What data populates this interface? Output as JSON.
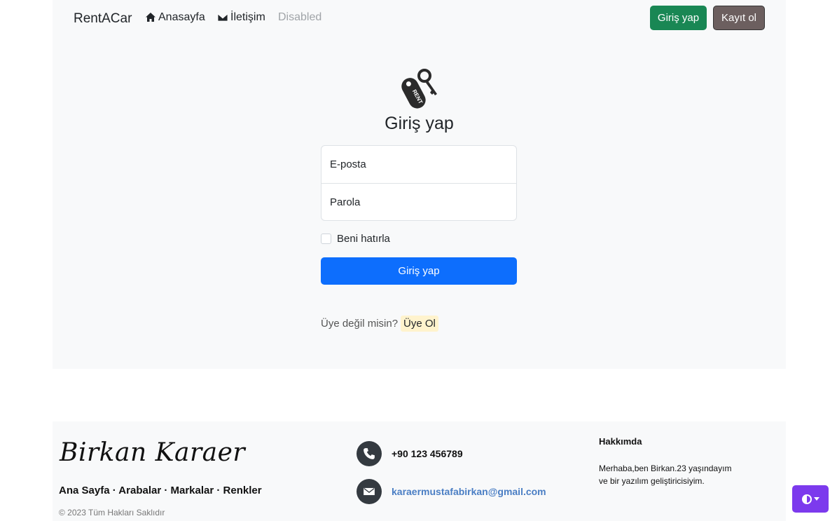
{
  "navbar": {
    "brand": "RentACar",
    "links": [
      {
        "label": "Anasayfa",
        "icon": "home-icon"
      },
      {
        "label": "İletişim",
        "icon": "envelope-icon"
      },
      {
        "label": "Disabled"
      }
    ],
    "login_button": "Giriş yap",
    "register_button": "Kayıt ol"
  },
  "login": {
    "logo_text": "RENT",
    "title": "Giriş yap",
    "email_placeholder": "E-posta",
    "password_placeholder": "Parola",
    "remember_label": "Beni hatırla",
    "submit_label": "Giriş yap",
    "signup_prompt": "Üye değil misin?",
    "signup_link": "Üye Ol"
  },
  "footer": {
    "name": "Birkan Karaer",
    "links": "Ana Sayfa · Arabalar · Markalar · Renkler",
    "copyright": "© 2023 Tüm Hakları Saklıdır",
    "phone": "+90 123 456789",
    "email": "karaermustafabirkan@gmail.com",
    "about_title": "Hakkımda",
    "about_text_line1": "Merhaba,ben Birkan.23 yaşındayım",
    "about_text_line2": "ve bir yazılım geliştiricisiyim."
  },
  "colors": {
    "success": "#198754",
    "primary": "#0d6efd",
    "accent": "#7c3aed"
  }
}
